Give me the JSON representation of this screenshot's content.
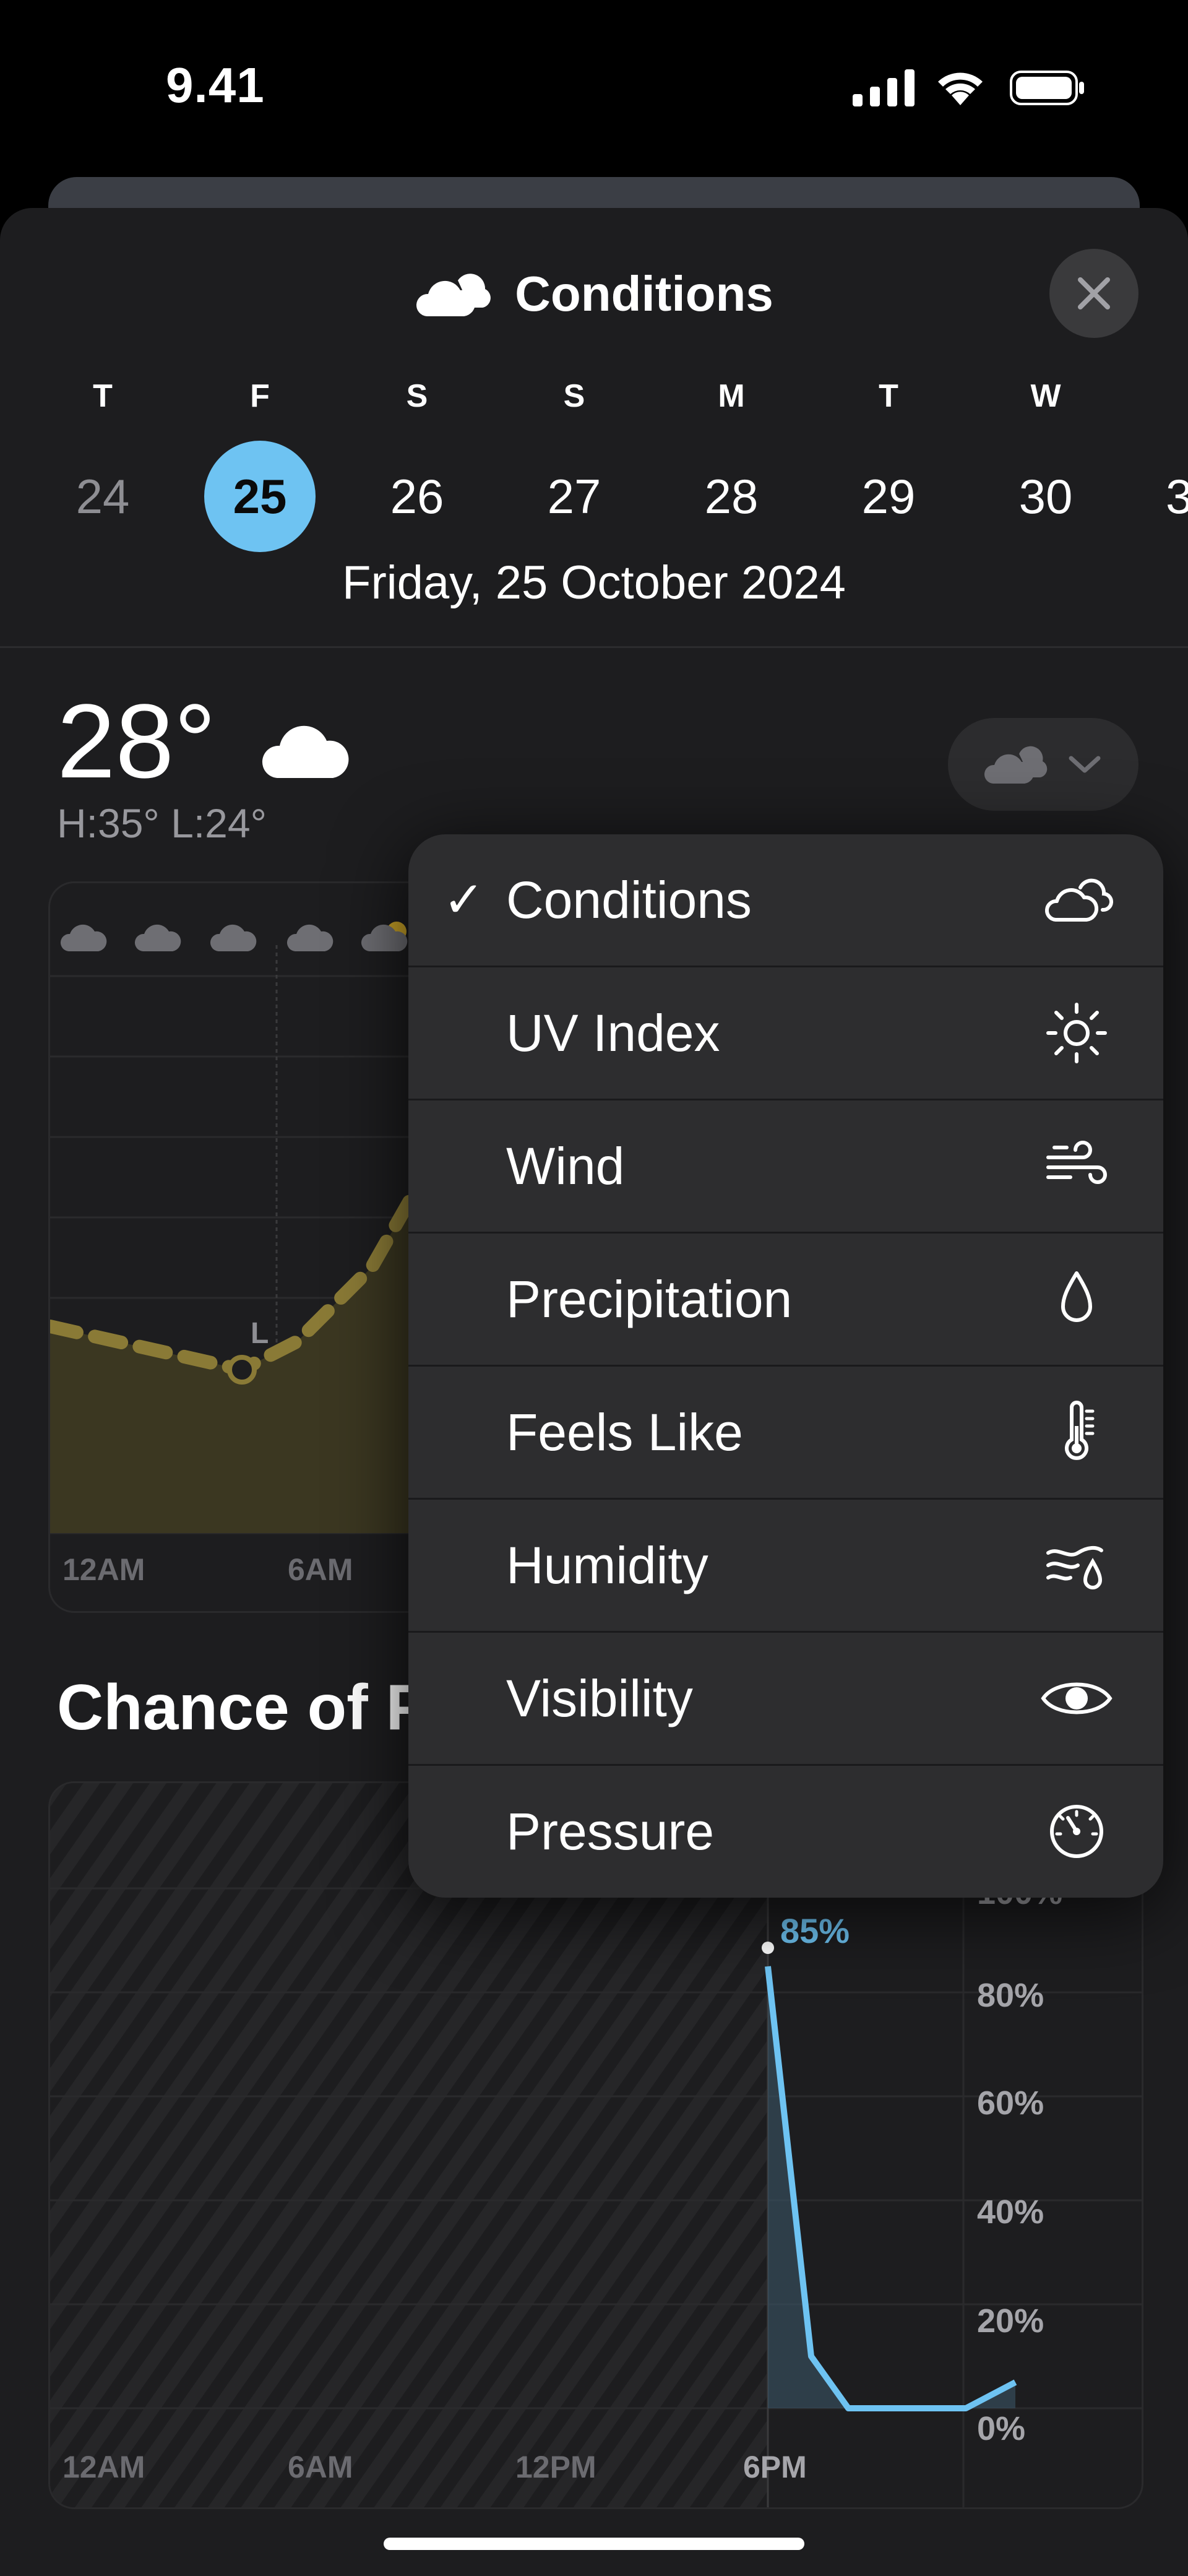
{
  "status_bar": {
    "time": "9.41"
  },
  "header": {
    "title": "Conditions",
    "close_icon": "close-icon",
    "title_icon": "cloud-icon"
  },
  "days": [
    {
      "dow": "T",
      "num": "24",
      "state": "past"
    },
    {
      "dow": "F",
      "num": "25",
      "state": "selected"
    },
    {
      "dow": "S",
      "num": "26",
      "state": "normal"
    },
    {
      "dow": "S",
      "num": "27",
      "state": "normal"
    },
    {
      "dow": "M",
      "num": "28",
      "state": "normal"
    },
    {
      "dow": "T",
      "num": "29",
      "state": "normal"
    },
    {
      "dow": "W",
      "num": "30",
      "state": "normal"
    },
    {
      "dow": "",
      "num": "3",
      "state": "normal"
    }
  ],
  "date_full": "Friday, 25 October 2024",
  "current": {
    "temp": "28°",
    "hilo": "H:35° L:24°",
    "icon": "cloud-icon"
  },
  "condition_chart": {
    "x_labels": [
      "12AM",
      "6AM"
    ],
    "low_marker": "L",
    "hour_icons": [
      "cloud-icon",
      "cloud-icon",
      "cloud-icon",
      "cloud-icon",
      "partly-sunny-icon"
    ]
  },
  "chance_title": "Chance of P",
  "chart_data": {
    "type": "line",
    "title": "Chance of P",
    "x_labels": [
      "12AM",
      "6AM",
      "12PM",
      "6PM"
    ],
    "y_labels": [
      "100%",
      "80%",
      "60%",
      "40%",
      "20%",
      "0%"
    ],
    "ylim": [
      0,
      100
    ],
    "series": [
      {
        "x": [
          "6PM",
          "7PM",
          "8PM",
          "9PM",
          "10PM",
          "11PM"
        ],
        "values": [
          85,
          10,
          0,
          0,
          0,
          5
        ]
      }
    ],
    "annotation": "85%",
    "accent": "#6ec3f2"
  },
  "menu": {
    "items": [
      {
        "label": "Conditions",
        "icon": "cloud-sun-icon",
        "checked": "✓"
      },
      {
        "label": "UV Index",
        "icon": "sun-icon"
      },
      {
        "label": "Wind",
        "icon": "wind-icon"
      },
      {
        "label": "Precipitation",
        "icon": "raindrop-icon"
      },
      {
        "label": "Feels Like",
        "icon": "thermometer-icon"
      },
      {
        "label": "Humidity",
        "icon": "humidity-icon"
      },
      {
        "label": "Visibility",
        "icon": "eye-icon"
      },
      {
        "label": "Pressure",
        "icon": "gauge-icon"
      }
    ]
  },
  "colors": {
    "accent_blue": "#6ec3f2",
    "temp_line": "#8a7a36",
    "sheet_bg": "#1d1d1f",
    "menu_bg": "#2d2d2f"
  }
}
